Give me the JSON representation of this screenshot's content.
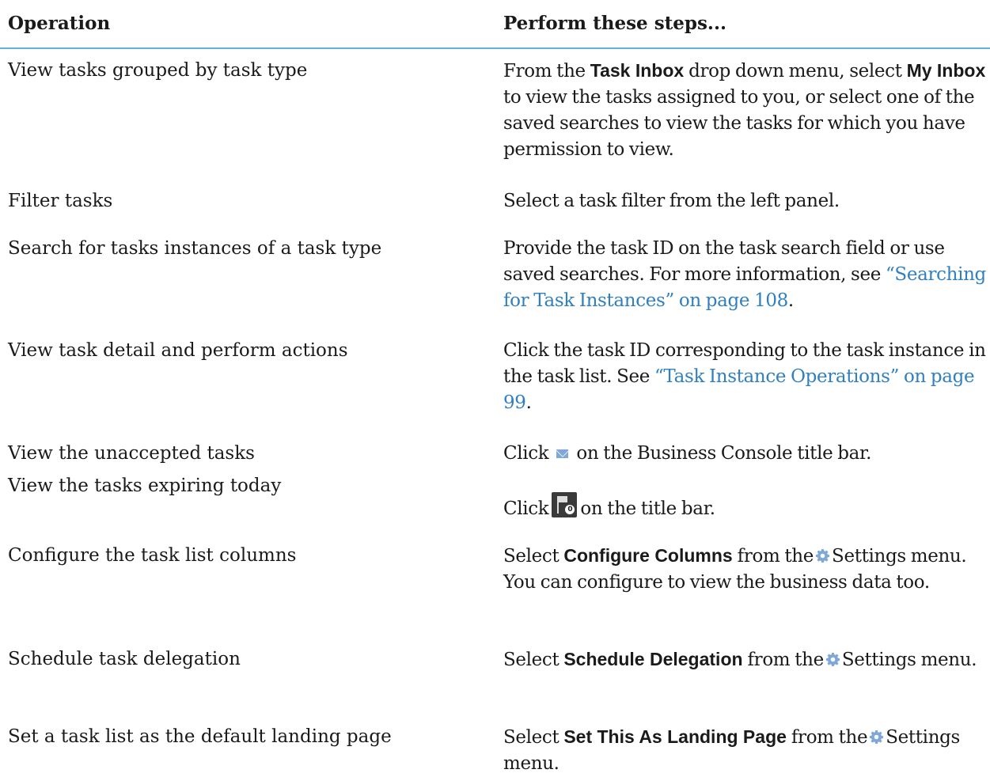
{
  "header": {
    "operation": "Operation",
    "steps": "Perform these steps..."
  },
  "rows": [
    {
      "op": "View tasks grouped by task type",
      "s1": "From the ",
      "b1": "Task Inbox",
      "s2": " drop down menu, select ",
      "b2": "My Inbox",
      "s3": " to view the tasks assigned to you, or select one of the saved searches to view the tasks for which you have permission to view."
    },
    {
      "op": "Filter tasks",
      "s1": "Select a task filter from the left panel."
    },
    {
      "op": "Search for tasks instances of a task type",
      "s1": "Provide the task ID on the task search field or use saved searches. For more information, see ",
      "link": "“Searching for Task Instances” on page 108",
      "s2": "."
    },
    {
      "op": "View task detail and perform actions",
      "s1": "Click the task ID corresponding to the task instance in the task list. See ",
      "link": "“Task Instance Operations” on page 99",
      "s2": "."
    },
    {
      "op": "View the unaccepted tasks",
      "s1": "Click",
      "icon": "mail-icon",
      "s2": "on the Business Console title bar."
    },
    {
      "op": "View the tasks expiring today",
      "s1": "Click",
      "icon": "flag-icon",
      "badge": "0",
      "s2": "on the title bar."
    },
    {
      "op": "Configure the task list columns",
      "s1": "Select ",
      "b1": "Configure Columns",
      "s2": " from the",
      "icon": "gear-icon",
      "s3": "Settings menu. You can configure to view the business data too."
    },
    {
      "op": "Schedule task delegation",
      "s1": "Select ",
      "b1": "Schedule Delegation",
      "s2": " from the",
      "icon": "gear-icon",
      "s3": "Settings menu."
    },
    {
      "op": "Set a task list as the default landing page",
      "s1": "Select ",
      "b1": "Set This As Landing Page",
      "s2": " from the",
      "icon": "gear-icon",
      "s3": "Settings menu."
    }
  ],
  "colors": {
    "rule": "#5fb3dd",
    "link": "#2f7fc1",
    "icon": "#7fa8d8"
  }
}
